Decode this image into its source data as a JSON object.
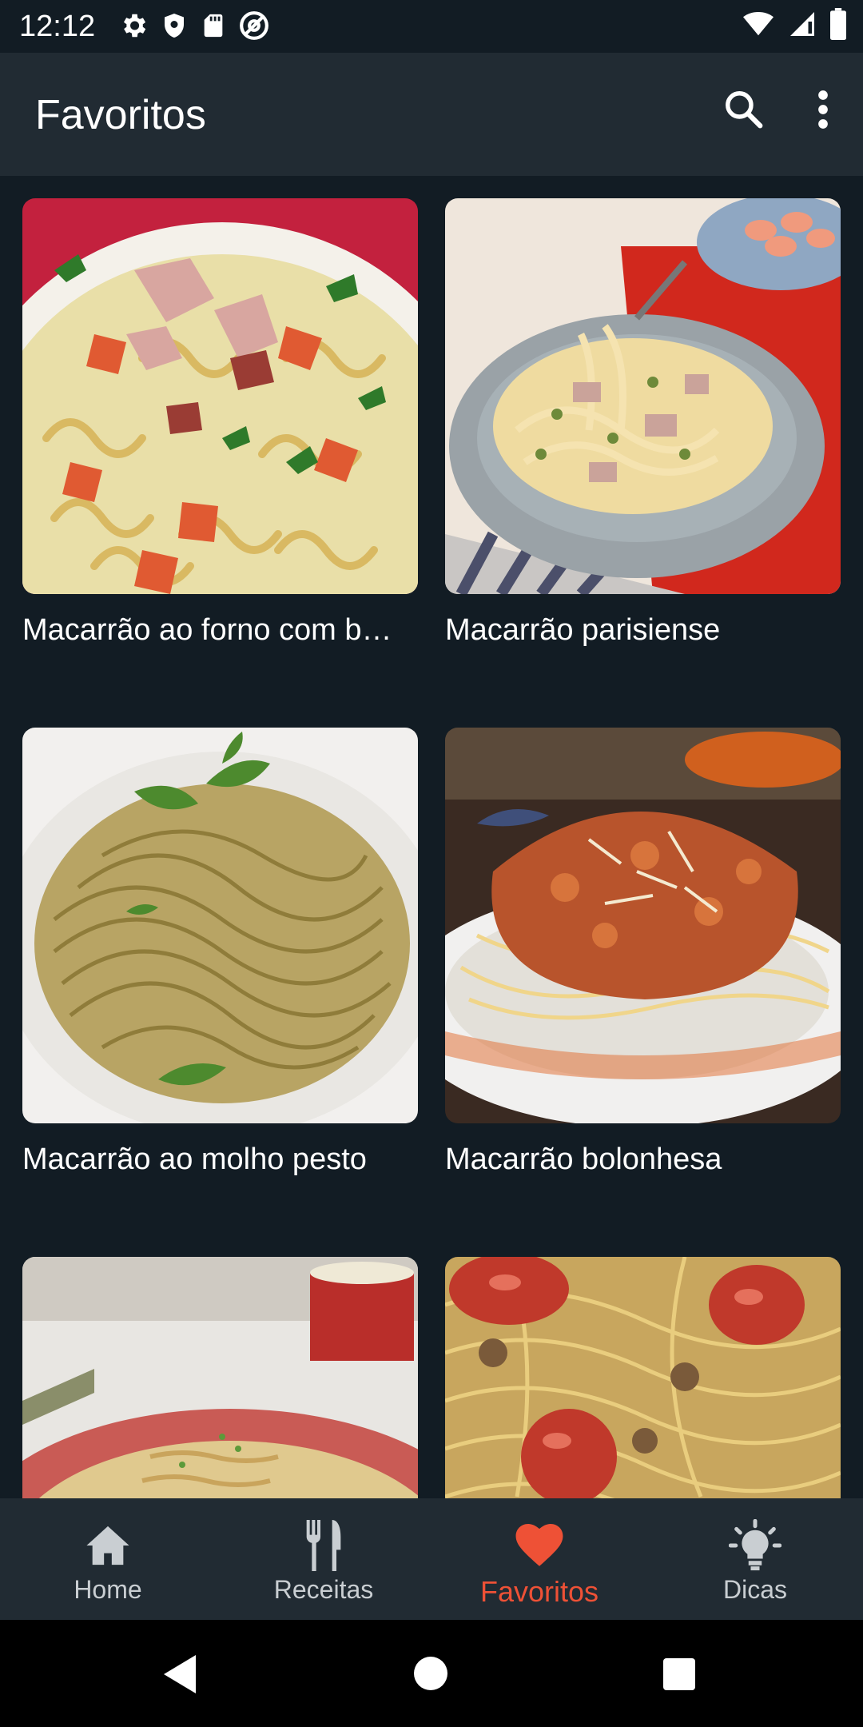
{
  "status": {
    "time": "12:12",
    "left_icons": [
      "gear-icon",
      "shield-icon",
      "sd-card-icon",
      "at-sign-icon"
    ],
    "right_icons": [
      "wifi-icon",
      "signal-icon",
      "battery-icon"
    ]
  },
  "app_bar": {
    "title": "Favoritos",
    "actions": [
      "search-icon",
      "more-vert-icon"
    ]
  },
  "recipes": [
    {
      "title": "Macarrão ao forno com b…",
      "image": "pasta-with-bacon-and-tomato"
    },
    {
      "title": "Macarrão parisiense",
      "image": "creamy-pasta-with-ham-and-peas"
    },
    {
      "title": "Macarrão ao molho pesto",
      "image": "pesto-linguine-with-basil"
    },
    {
      "title": "Macarrão bolonhesa",
      "image": "spaghetti-bolognese"
    },
    {
      "title": "",
      "image": "pasta-with-red-plate"
    },
    {
      "title": "",
      "image": "spaghetti-with-sausage"
    }
  ],
  "bottom_nav": {
    "items": [
      {
        "label": "Home",
        "icon": "home-icon"
      },
      {
        "label": "Receitas",
        "icon": "fork-knife-icon"
      },
      {
        "label": "Favoritos",
        "icon": "heart-icon"
      },
      {
        "label": "Dicas",
        "icon": "lightbulb-icon"
      }
    ],
    "active": "Favoritos"
  },
  "colors": {
    "background": "#121c24",
    "app_bar": "#212b33",
    "accent": "#ee5136",
    "inactive_label": "#c9ced2"
  }
}
